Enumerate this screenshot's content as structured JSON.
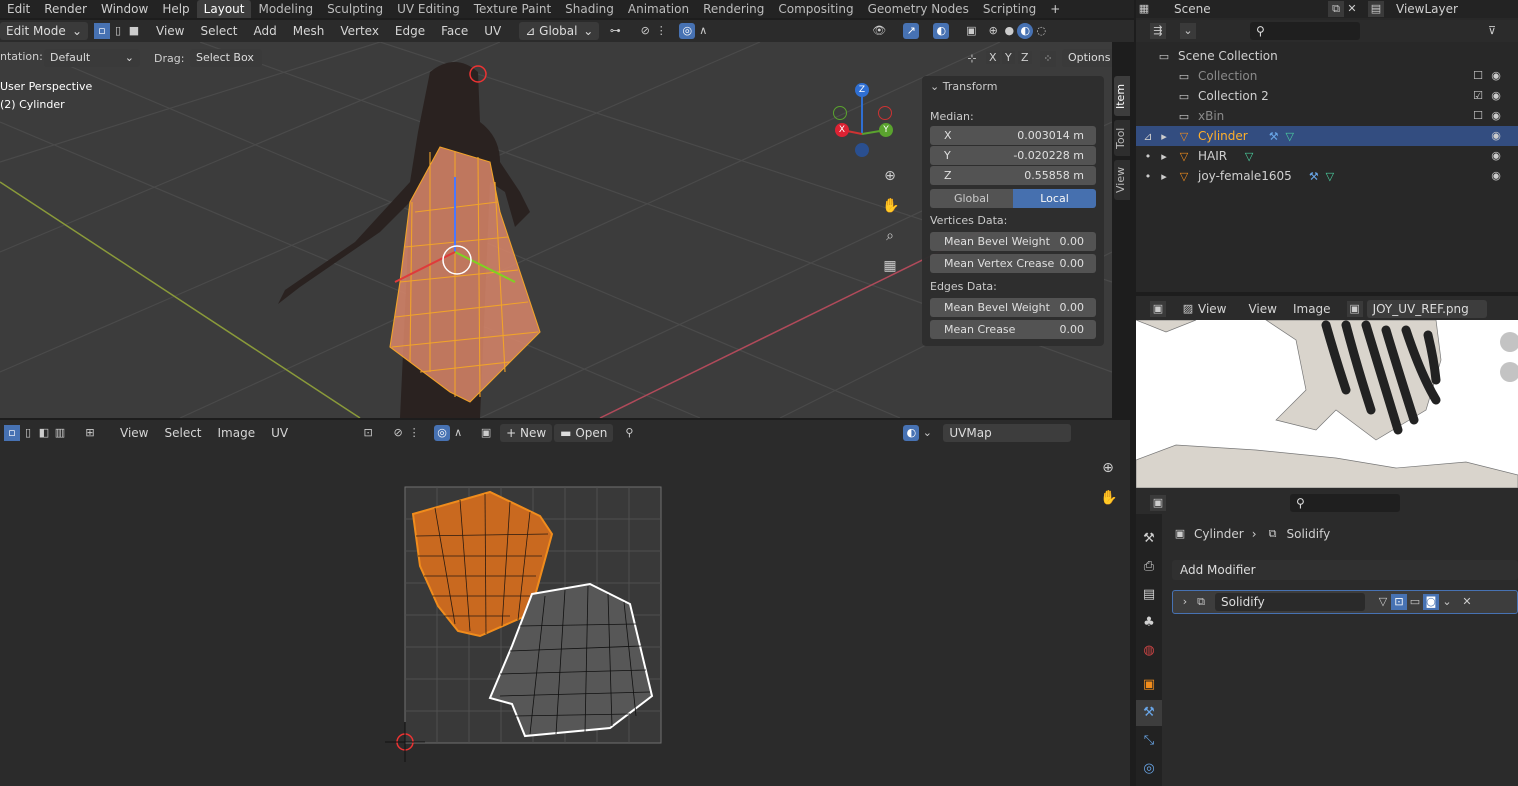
{
  "topbar": {
    "menus": [
      "Edit",
      "Render",
      "Window",
      "Help"
    ],
    "workspaces": [
      "Layout",
      "Modeling",
      "Sculpting",
      "UV Editing",
      "Texture Paint",
      "Shading",
      "Animation",
      "Rendering",
      "Compositing",
      "Geometry Nodes",
      "Scripting"
    ],
    "add": "+"
  },
  "scene": {
    "label": "Scene",
    "view_layer": "ViewLayer"
  },
  "viewport": {
    "mode": "Edit Mode",
    "menus": [
      "View",
      "Select",
      "Add",
      "Mesh",
      "Vertex",
      "Edge",
      "Face",
      "UV"
    ],
    "orientation": "Global",
    "orientation_label": "ntation:",
    "orientation_value": "Default",
    "drag_label": "Drag:",
    "drag_value": "Select Box",
    "axes": [
      "X",
      "Y",
      "Z"
    ],
    "options": "Options",
    "overlay_line1": "User Perspective",
    "overlay_line2": "(2) Cylinder",
    "gizmo": {
      "z": "Z",
      "x": "X",
      "y": "Y"
    }
  },
  "npanel": {
    "header": "Transform",
    "median": "Median:",
    "x_label": "X",
    "x_value": "0.003014 m",
    "y_label": "Y",
    "y_value": "-0.020228 m",
    "z_label": "Z",
    "z_value": "0.55858 m",
    "global": "Global",
    "local": "Local",
    "vertices_data": "Vertices Data:",
    "mean_bevel_weight": "Mean Bevel Weight",
    "mbw_value": "0.00",
    "mean_vertex_crease": "Mean Vertex Crease",
    "mvc_value": "0.00",
    "edges_data": "Edges Data:",
    "edge_mbw": "Mean Bevel Weight",
    "edge_mbw_value": "0.00",
    "mean_crease": "Mean Crease",
    "mc_value": "0.00"
  },
  "side_tabs": [
    "Item",
    "Tool",
    "View"
  ],
  "uv_editor": {
    "menus": [
      "View",
      "Select",
      "Image",
      "UV"
    ],
    "new": "New",
    "open": "Open",
    "uvmap": "UVMap"
  },
  "outliner": {
    "root": "Scene Collection",
    "rows": [
      {
        "name": "Collection"
      },
      {
        "name": "Collection 2"
      },
      {
        "name": "xBin"
      },
      {
        "name": "Cylinder"
      },
      {
        "name": "HAIR"
      },
      {
        "name": "joy-female1605"
      }
    ]
  },
  "image_editor": {
    "menus": [
      "View",
      "View",
      "Image"
    ],
    "image_name": "JOY_UV_REF.png"
  },
  "properties": {
    "breadcrumb_object": "Cylinder",
    "breadcrumb_modifier": "Solidify",
    "add_modifier": "Add Modifier",
    "modifier_name": "Solidify"
  },
  "colors": {
    "accent": "#4772b3",
    "selected_orange": "#f08c1c",
    "active_text": "#ffaf29"
  }
}
